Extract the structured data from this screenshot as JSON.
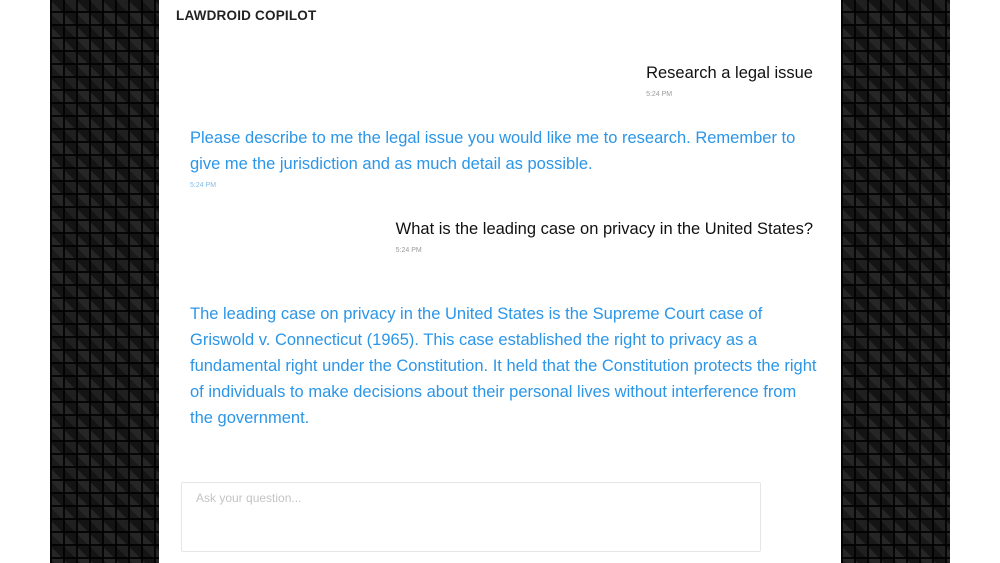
{
  "app": {
    "title": "LAWDROID COPILOT"
  },
  "messages": [
    {
      "sender": "user",
      "text": "Research a legal issue",
      "time": "5:24 PM"
    },
    {
      "sender": "bot",
      "text": "Please describe to me the legal issue you would like me to research. Remember to give me the jurisdiction and as much detail as possible.",
      "time": "5:24 PM"
    },
    {
      "sender": "user",
      "text": "What is the leading case on privacy in the United States?",
      "time": "5:24 PM"
    },
    {
      "sender": "bot",
      "text": "The leading case on privacy in the United States is the Supreme Court case of Griswold v. Connecticut (1965). This case established the right to privacy as a fundamental right under the Constitution. It held that the Constitution protects the right of individuals to make decisions about their personal lives without interference from the government."
    }
  ],
  "composer": {
    "placeholder": "Ask your question...",
    "value": ""
  },
  "colors": {
    "user_text": "#111111",
    "bot_text": "#2b96e8",
    "side_background": "#0b0b0b"
  }
}
